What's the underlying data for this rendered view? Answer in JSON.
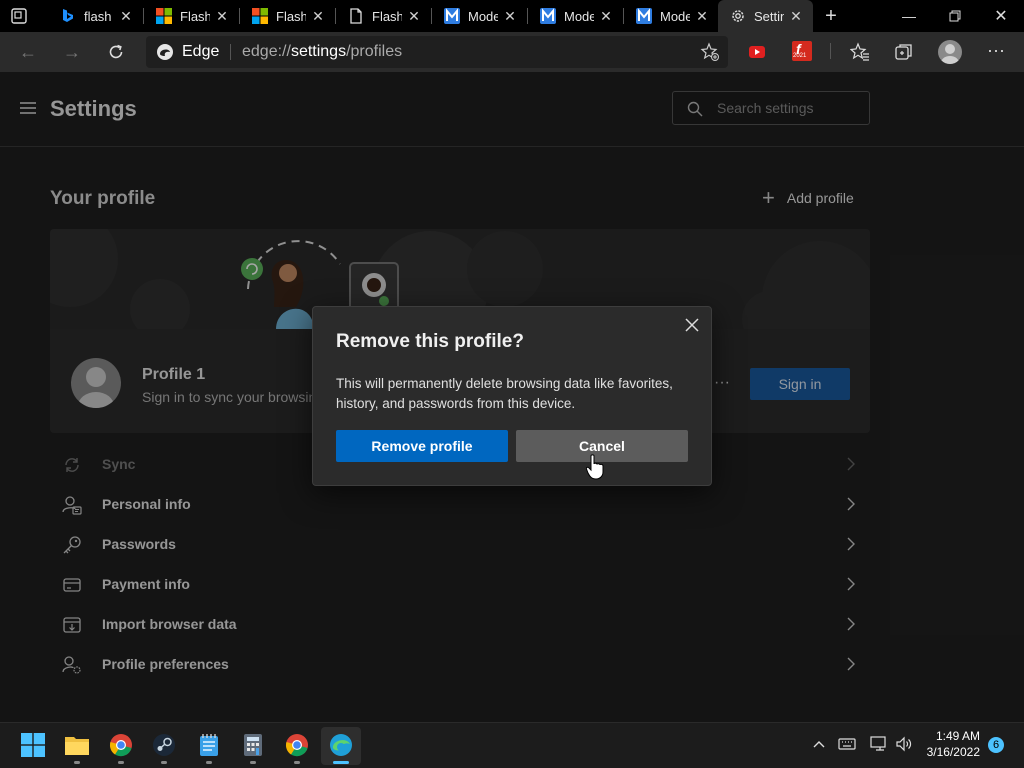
{
  "tabs": [
    {
      "title": "flash",
      "icon": "bing-icon"
    },
    {
      "title": "Flash",
      "icon": "microsoft-icon"
    },
    {
      "title": "Flash",
      "icon": "microsoft-icon"
    },
    {
      "title": "Flash",
      "icon": "page-icon"
    },
    {
      "title": "Mode",
      "icon": "m-icon"
    },
    {
      "title": "Mode",
      "icon": "m-icon"
    },
    {
      "title": "Mode",
      "icon": "m-icon"
    },
    {
      "title": "Settin",
      "icon": "gear-icon"
    }
  ],
  "address": {
    "brand": "Edge",
    "scheme": "edge://",
    "host": "settings",
    "path": "/profiles"
  },
  "extensions": {
    "badge_2021": "2021"
  },
  "settings": {
    "title": "Settings",
    "search_placeholder": "Search settings",
    "section_title": "Your profile",
    "add_profile": "Add profile",
    "profile_name": "Profile 1",
    "profile_sub": "Sign in to sync your browsing",
    "sign_in": "Sign in",
    "more": "···",
    "items": [
      {
        "label": "Sync",
        "icon": "sync-icon",
        "disabled": true
      },
      {
        "label": "Personal info",
        "icon": "person-info-icon",
        "disabled": false
      },
      {
        "label": "Passwords",
        "icon": "key-icon",
        "disabled": false
      },
      {
        "label": "Payment info",
        "icon": "card-icon",
        "disabled": false
      },
      {
        "label": "Import browser data",
        "icon": "import-icon",
        "disabled": false
      },
      {
        "label": "Profile preferences",
        "icon": "profile-prefs-icon",
        "disabled": false
      }
    ]
  },
  "dialog": {
    "title": "Remove this profile?",
    "body": "This will permanently delete browsing data like favorites, history, and passwords from this device.",
    "confirm": "Remove profile",
    "cancel": "Cancel"
  },
  "taskbar": {
    "time": "1:49 AM",
    "date": "3/16/2022",
    "notification_count": "6"
  },
  "colors": {
    "accent": "#0067c0",
    "signin": "#1a5a9e",
    "cancel": "#5c5c5c"
  }
}
